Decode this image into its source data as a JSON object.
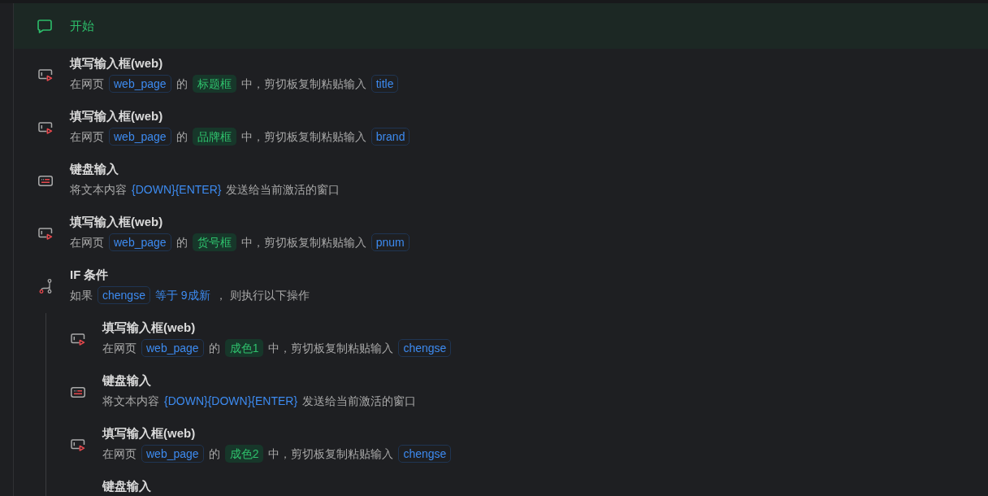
{
  "start": {
    "label": "开始"
  },
  "steps": [
    {
      "kind": "fill_input",
      "title": "填写输入框(web)",
      "description": [
        {
          "kind": "text",
          "text": "在网页"
        },
        {
          "kind": "variable",
          "text": "web_page"
        },
        {
          "kind": "text",
          "text": "的"
        },
        {
          "kind": "element",
          "text": "标题框"
        },
        {
          "kind": "text",
          "text": "中，剪切板复制粘贴输入"
        },
        {
          "kind": "variable",
          "text": "title"
        }
      ]
    },
    {
      "kind": "fill_input",
      "title": "填写输入框(web)",
      "description": [
        {
          "kind": "text",
          "text": "在网页"
        },
        {
          "kind": "variable",
          "text": "web_page"
        },
        {
          "kind": "text",
          "text": "的"
        },
        {
          "kind": "element",
          "text": "品牌框"
        },
        {
          "kind": "text",
          "text": "中，剪切板复制粘贴输入"
        },
        {
          "kind": "variable",
          "text": "brand"
        }
      ]
    },
    {
      "kind": "keyboard",
      "title": "键盘输入",
      "description": [
        {
          "kind": "text",
          "text": "将文本内容"
        },
        {
          "kind": "value",
          "text": "{DOWN}{ENTER}"
        },
        {
          "kind": "text",
          "text": "发送给当前激活的窗口"
        }
      ]
    },
    {
      "kind": "fill_input",
      "title": "填写输入框(web)",
      "description": [
        {
          "kind": "text",
          "text": "在网页"
        },
        {
          "kind": "variable",
          "text": "web_page"
        },
        {
          "kind": "text",
          "text": "的"
        },
        {
          "kind": "element",
          "text": "货号框"
        },
        {
          "kind": "text",
          "text": "中，剪切板复制粘贴输入"
        },
        {
          "kind": "variable",
          "text": "pnum"
        }
      ]
    },
    {
      "kind": "condition",
      "title": "IF 条件",
      "description": [
        {
          "kind": "text",
          "text": "如果"
        },
        {
          "kind": "variable",
          "text": "chengse"
        },
        {
          "kind": "value",
          "text": "等于 9成新"
        },
        {
          "kind": "text",
          "text": "， 则执行以下操作"
        }
      ],
      "children": [
        {
          "kind": "fill_input",
          "title": "填写输入框(web)",
          "description": [
            {
              "kind": "text",
              "text": "在网页"
            },
            {
              "kind": "variable",
              "text": "web_page"
            },
            {
              "kind": "text",
              "text": "的"
            },
            {
              "kind": "element",
              "text": "成色1"
            },
            {
              "kind": "text",
              "text": "中，剪切板复制粘贴输入"
            },
            {
              "kind": "variable",
              "text": "chengse"
            }
          ]
        },
        {
          "kind": "keyboard",
          "title": "键盘输入",
          "description": [
            {
              "kind": "text",
              "text": "将文本内容"
            },
            {
              "kind": "value",
              "text": "{DOWN}{DOWN}{ENTER}"
            },
            {
              "kind": "text",
              "text": "发送给当前激活的窗口"
            }
          ]
        },
        {
          "kind": "fill_input",
          "title": "填写输入框(web)",
          "description": [
            {
              "kind": "text",
              "text": "在网页"
            },
            {
              "kind": "variable",
              "text": "web_page"
            },
            {
              "kind": "text",
              "text": "的"
            },
            {
              "kind": "element",
              "text": "成色2"
            },
            {
              "kind": "text",
              "text": "中，剪切板复制粘贴输入"
            },
            {
              "kind": "variable",
              "text": "chengse"
            }
          ]
        },
        {
          "title": "键盘输入"
        }
      ]
    }
  ]
}
